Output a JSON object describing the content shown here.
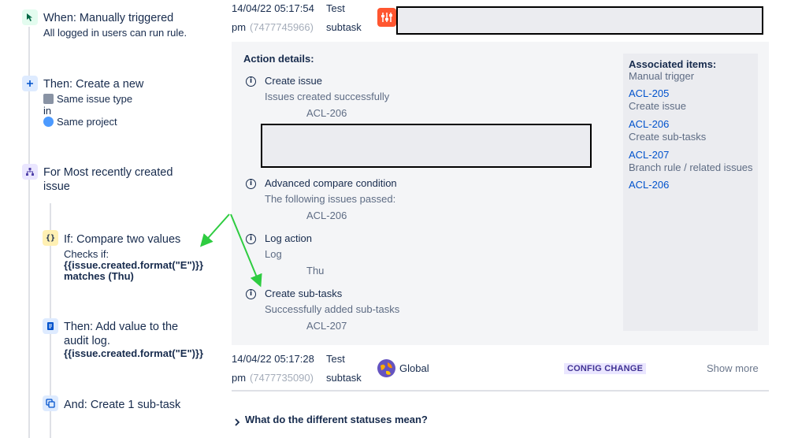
{
  "flow": {
    "trigger": {
      "title": "When: Manually triggered",
      "subtitle": "All logged in users can run rule."
    },
    "create_new": {
      "title": "Then: Create a new",
      "issue_type": "Same issue type",
      "in_label": "in",
      "project": "Same project"
    },
    "branch": {
      "title_line1": "For Most recently created",
      "title_line2": "issue"
    },
    "condition": {
      "title": "If: Compare two values",
      "checks_label": "Checks if:",
      "expr": "{{issue.created.format(\"E\")}}",
      "match": "matches (Thu)"
    },
    "log": {
      "title_line1": "Then: Add value to the",
      "title_line2": "audit log.",
      "expr": "{{issue.created.format(\"E\")}}"
    },
    "subtask": {
      "title": "And: Create 1 sub-task"
    }
  },
  "entries": [
    {
      "date": "14/04/22 05:17:54",
      "ampm": "pm",
      "id": "(7477745966)",
      "actor_line1": "Test",
      "actor_line2": "subtask"
    },
    {
      "date": "14/04/22 05:17:28",
      "ampm": "pm",
      "id": "(7477735090)",
      "actor_line1": "Test",
      "actor_line2": "subtask",
      "scope": "Global",
      "status": "CONFIG CHANGE",
      "show_more": "Show more"
    }
  ],
  "details": {
    "heading": "Action details:",
    "actions": [
      {
        "title": "Create issue",
        "message": "Issues created successfully",
        "value": "ACL-206"
      },
      {
        "title": "Advanced compare condition",
        "message": "The following issues passed:",
        "value": "ACL-206"
      },
      {
        "title": "Log action",
        "message": "Log",
        "value": "Thu"
      },
      {
        "title": "Create sub-tasks",
        "message": "Successfully added sub-tasks",
        "value": "ACL-207"
      }
    ],
    "associated": {
      "heading": "Associated items:",
      "trigger": "Manual trigger",
      "items": [
        {
          "key": "ACL-205",
          "desc": "Create issue"
        },
        {
          "key": "ACL-206",
          "desc": "Create sub-tasks"
        },
        {
          "key": "ACL-207",
          "desc": "Branch rule / related issues"
        },
        {
          "key": "ACL-206",
          "desc": ""
        }
      ]
    }
  },
  "footer": {
    "statuses_link": "What do the different statuses mean?"
  },
  "colors": {
    "accent": "#0052cc",
    "annotation_arrow": "#2ecc40",
    "lozenge_bg": "#eae6ff",
    "lozenge_text": "#403294"
  },
  "icons": [
    "cursor-icon",
    "plus-icon",
    "branch-icon",
    "braces-icon",
    "document-icon",
    "subtask-icon",
    "info-icon",
    "globe-icon",
    "chevron-right-icon",
    "jira-app-icon"
  ]
}
